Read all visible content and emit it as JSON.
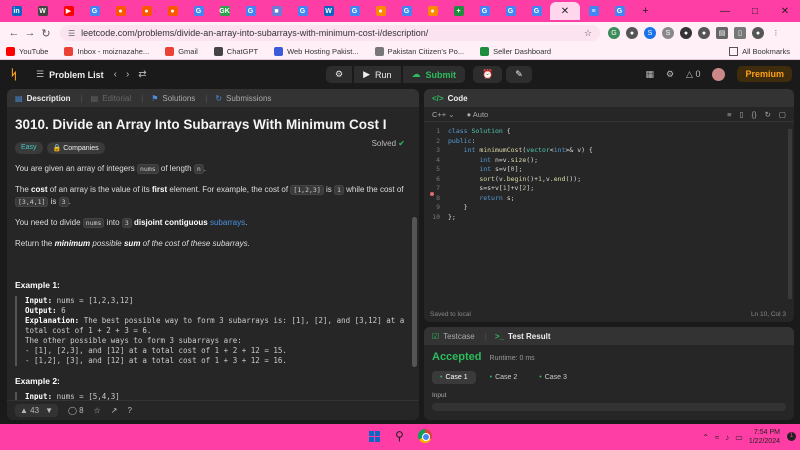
{
  "browser": {
    "url": "leetcode.com/problems/divide-an-array-into-subarrays-with-minimum-cost-i/description/",
    "tab_favicons": [
      {
        "glyph": "in",
        "color": "#0a66c2"
      },
      {
        "glyph": "W",
        "color": "#444444"
      },
      {
        "glyph": "▶",
        "color": "#ff0000"
      },
      {
        "glyph": "G",
        "color": "#4285f4"
      },
      {
        "glyph": "●",
        "color": "#ff5700"
      },
      {
        "glyph": "●",
        "color": "#ff5700"
      },
      {
        "glyph": "●",
        "color": "#ff5700"
      },
      {
        "glyph": "G",
        "color": "#4285f4"
      },
      {
        "glyph": "GK",
        "color": "#2ca24c"
      },
      {
        "glyph": "G",
        "color": "#4285f4"
      },
      {
        "glyph": "■",
        "color": "#6b7bd6"
      },
      {
        "glyph": "G",
        "color": "#4285f4"
      },
      {
        "glyph": "W",
        "color": "#0a66c2"
      },
      {
        "glyph": "G",
        "color": "#4285f4"
      },
      {
        "glyph": "●",
        "color": "#ff8a00"
      },
      {
        "glyph": "G",
        "color": "#4285f4"
      },
      {
        "glyph": "●",
        "color": "#ff8a00"
      },
      {
        "glyph": "+",
        "color": "#1e8e3e"
      },
      {
        "glyph": "G",
        "color": "#4285f4"
      },
      {
        "glyph": "G",
        "color": "#4285f4"
      },
      {
        "glyph": "G",
        "color": "#4285f4"
      },
      {
        "glyph": "≡",
        "color": "#4285f4"
      },
      {
        "glyph": "G",
        "color": "#4285f4"
      }
    ],
    "bookmarks": [
      {
        "label": "YouTube",
        "color": "#ff0000"
      },
      {
        "label": "Inbox - moiznazahe...",
        "color": "#ea4335"
      },
      {
        "label": "Gmail",
        "color": "#ea4335"
      },
      {
        "label": "ChatGPT",
        "color": "#444444"
      },
      {
        "label": "Web Hosting Pakist...",
        "color": "#3b5bdb"
      },
      {
        "label": "Pakistan Citizen's Po...",
        "color": "#777777"
      },
      {
        "label": "Seller Dashboard",
        "color": "#1e8e3e"
      }
    ],
    "all_bookmarks": "All Bookmarks"
  },
  "nav": {
    "problem_list": "Problem List",
    "run": "Run",
    "submit": "Submit",
    "streak": "0",
    "premium": "Premium"
  },
  "left_tabs": {
    "description": "Description",
    "editorial": "Editorial",
    "solutions": "Solutions",
    "submissions": "Submissions"
  },
  "problem": {
    "title": "3010. Divide an Array Into Subarrays With Minimum Cost I",
    "status": "Solved",
    "difficulty": "Easy",
    "companies": "Companies",
    "p1_a": "You are given an array of integers",
    "p1_code1": "nums",
    "p1_b": "of length",
    "p1_code2": "n",
    "p1_c": ".",
    "p2_a": "The",
    "p2_b1": "cost",
    "p2_c": "of an array is the value of its",
    "p2_b2": "first",
    "p2_d": "element. For example, the cost of",
    "p2_code1": "[1,2,3]",
    "p2_e": "is",
    "p2_code2": "1",
    "p2_f": "while the cost of",
    "p2_code3": "[3,4,1]",
    "p2_g": "is",
    "p2_code4": "3",
    "p2_h": ".",
    "p3_a": "You need to divide",
    "p3_code1": "nums",
    "p3_b": "into",
    "p3_code2": "3",
    "p3_bold": "disjoint contiguous",
    "p3_link": "subarrays",
    "p3_c": ".",
    "p4_a": "Return the",
    "p4_b1": "minimum",
    "p4_c": "possible",
    "p4_b2": "sum",
    "p4_d": "of the cost of these subarrays.",
    "example1_title": "Example 1:",
    "example1": {
      "input_label": "Input:",
      "input": " nums = [1,2,3,12]",
      "output_label": "Output:",
      "output": " 6",
      "expl_label": "Explanation:",
      "expl1": " The best possible way to form 3 subarrays is: [1], [2], and [3,12] at a",
      "expl2": "total cost of 1 + 2 + 3 = 6.",
      "expl3": "The other possible ways to form 3 subarrays are:",
      "expl4": "- [1], [2,3], and [12] at a total cost of 1 + 2 + 12 = 15.",
      "expl5": "- [1,2], [3], and [12] at a total cost of 1 + 3 + 12 = 16."
    },
    "example2_title": "Example 2:",
    "example2": {
      "input_label": "Input:",
      "input": " nums = [5,4,3]"
    }
  },
  "left_footer": {
    "likes": "43",
    "comments": "8"
  },
  "code_panel": {
    "title": "Code",
    "language": "C++",
    "mode": "Auto",
    "saved": "Saved to local",
    "cursor": "Ln 10, Col 3",
    "lines": [
      "1",
      "2",
      "3",
      "4",
      "5",
      "6",
      "7",
      "8",
      "9",
      "10"
    ]
  },
  "result_panel": {
    "testcase": "Testcase",
    "test_result": "Test Result",
    "verdict": "Accepted",
    "runtime": "Runtime: 0 ms",
    "cases": [
      "Case 1",
      "Case 2",
      "Case 3"
    ],
    "input_label": "Input"
  },
  "taskbar": {
    "time": "7:54 PM",
    "date": "1/22/2024",
    "notifications": "1"
  }
}
